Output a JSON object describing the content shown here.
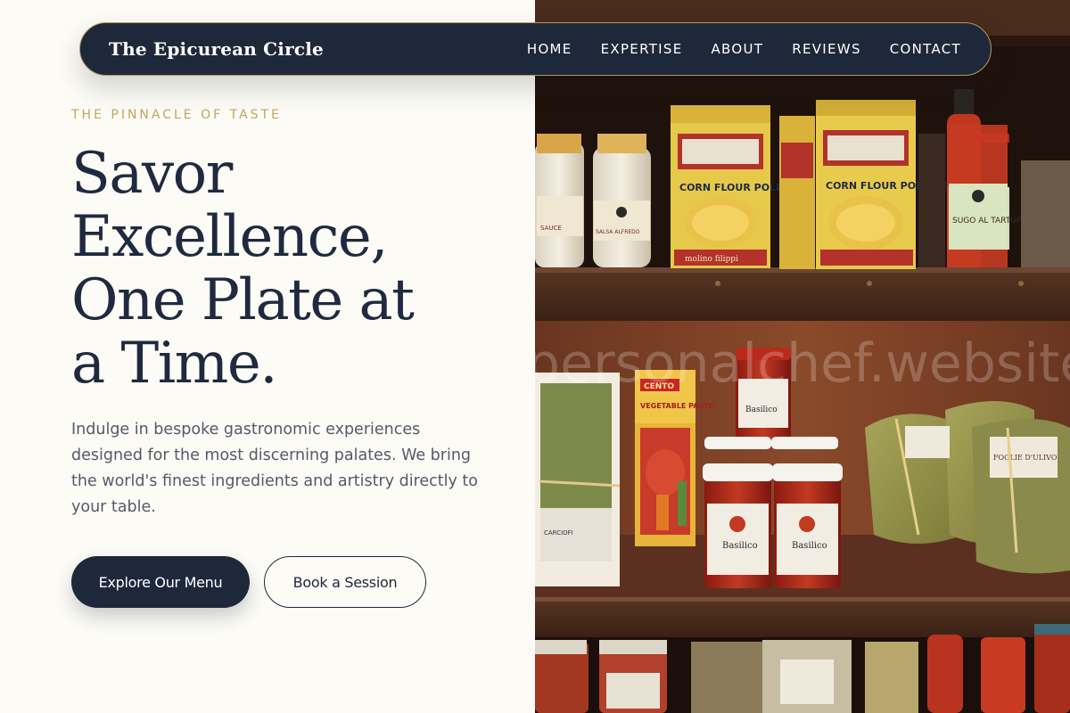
{
  "brand": "The Epicurean Circle",
  "nav": [
    {
      "label": "HOME"
    },
    {
      "label": "EXPERTISE"
    },
    {
      "label": "ABOUT"
    },
    {
      "label": "REVIEWS"
    },
    {
      "label": "CONTACT"
    }
  ],
  "hero": {
    "eyebrow": "THE PINNACLE OF TASTE",
    "headline_lines": [
      "Savor",
      "Excellence,",
      "One Plate at",
      "a Time."
    ],
    "intro": "Indulge in bespoke gastronomic experiences designed for the most discerning palates. We bring the world's finest ingredients and artistry directly to your table.",
    "primary_cta": "Explore Our Menu",
    "secondary_cta": "Book a Session"
  },
  "image": {
    "watermark": "personalchef.website",
    "labels": {
      "polenta": "CORN FLOUR POLENTA",
      "molino": "molino filippi",
      "sugo": "SUGO AL TARTUFO",
      "salsa": "SALSA ALFREDO",
      "vegetable_paste": "VEGETABLE PASTE",
      "cento": "CENTO",
      "basilico": "Basilico",
      "foglie": "FOGLIE D'ULIVO"
    }
  },
  "colors": {
    "navy": "#1e283b",
    "gold": "#c2a561",
    "cream": "#fcfbf5"
  }
}
